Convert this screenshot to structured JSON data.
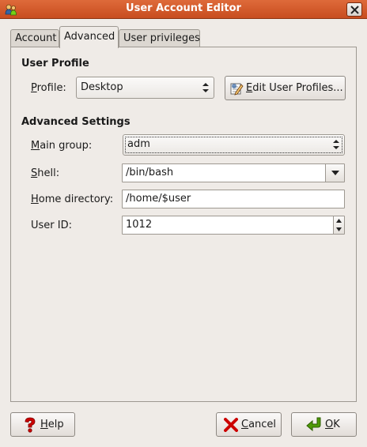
{
  "window": {
    "title": "User Account Editor",
    "app_icon": "users-icon",
    "close_icon": "close-icon"
  },
  "tabs": [
    {
      "label": "Account",
      "active": false
    },
    {
      "label": "Advanced",
      "active": true
    },
    {
      "label": "User privileges",
      "active": false
    }
  ],
  "user_profile": {
    "section_title": "User Profile",
    "profile_label_mnemonic": "P",
    "profile_label_rest": "rofile:",
    "profile_value": "Desktop",
    "edit_button_mnemonic": "E",
    "edit_button_rest": "dit User Profiles...",
    "edit_button_icon": "edit-profile-icon"
  },
  "advanced_settings": {
    "section_title": "Advanced Settings",
    "main_group": {
      "mnemonic": "M",
      "rest": "ain group:",
      "value": "adm"
    },
    "shell": {
      "mnemonic": "S",
      "rest": "hell:",
      "value": "/bin/bash"
    },
    "home_directory": {
      "mnemonic": "H",
      "rest": "ome directory:",
      "value": "/home/$user"
    },
    "user_id": {
      "label": "User ID:",
      "value": "1012"
    }
  },
  "footer": {
    "help": {
      "mnemonic": "H",
      "rest": "elp",
      "icon": "help-icon"
    },
    "cancel": {
      "mnemonic": "C",
      "rest": "ancel",
      "icon": "cancel-icon"
    },
    "ok": {
      "mnemonic": "O",
      "rest": "K",
      "icon": "ok-icon"
    }
  },
  "colors": {
    "titlebar": "#c84d1f",
    "background": "#efebe7",
    "help_red": "#cc0000",
    "ok_green": "#4e9a06"
  }
}
